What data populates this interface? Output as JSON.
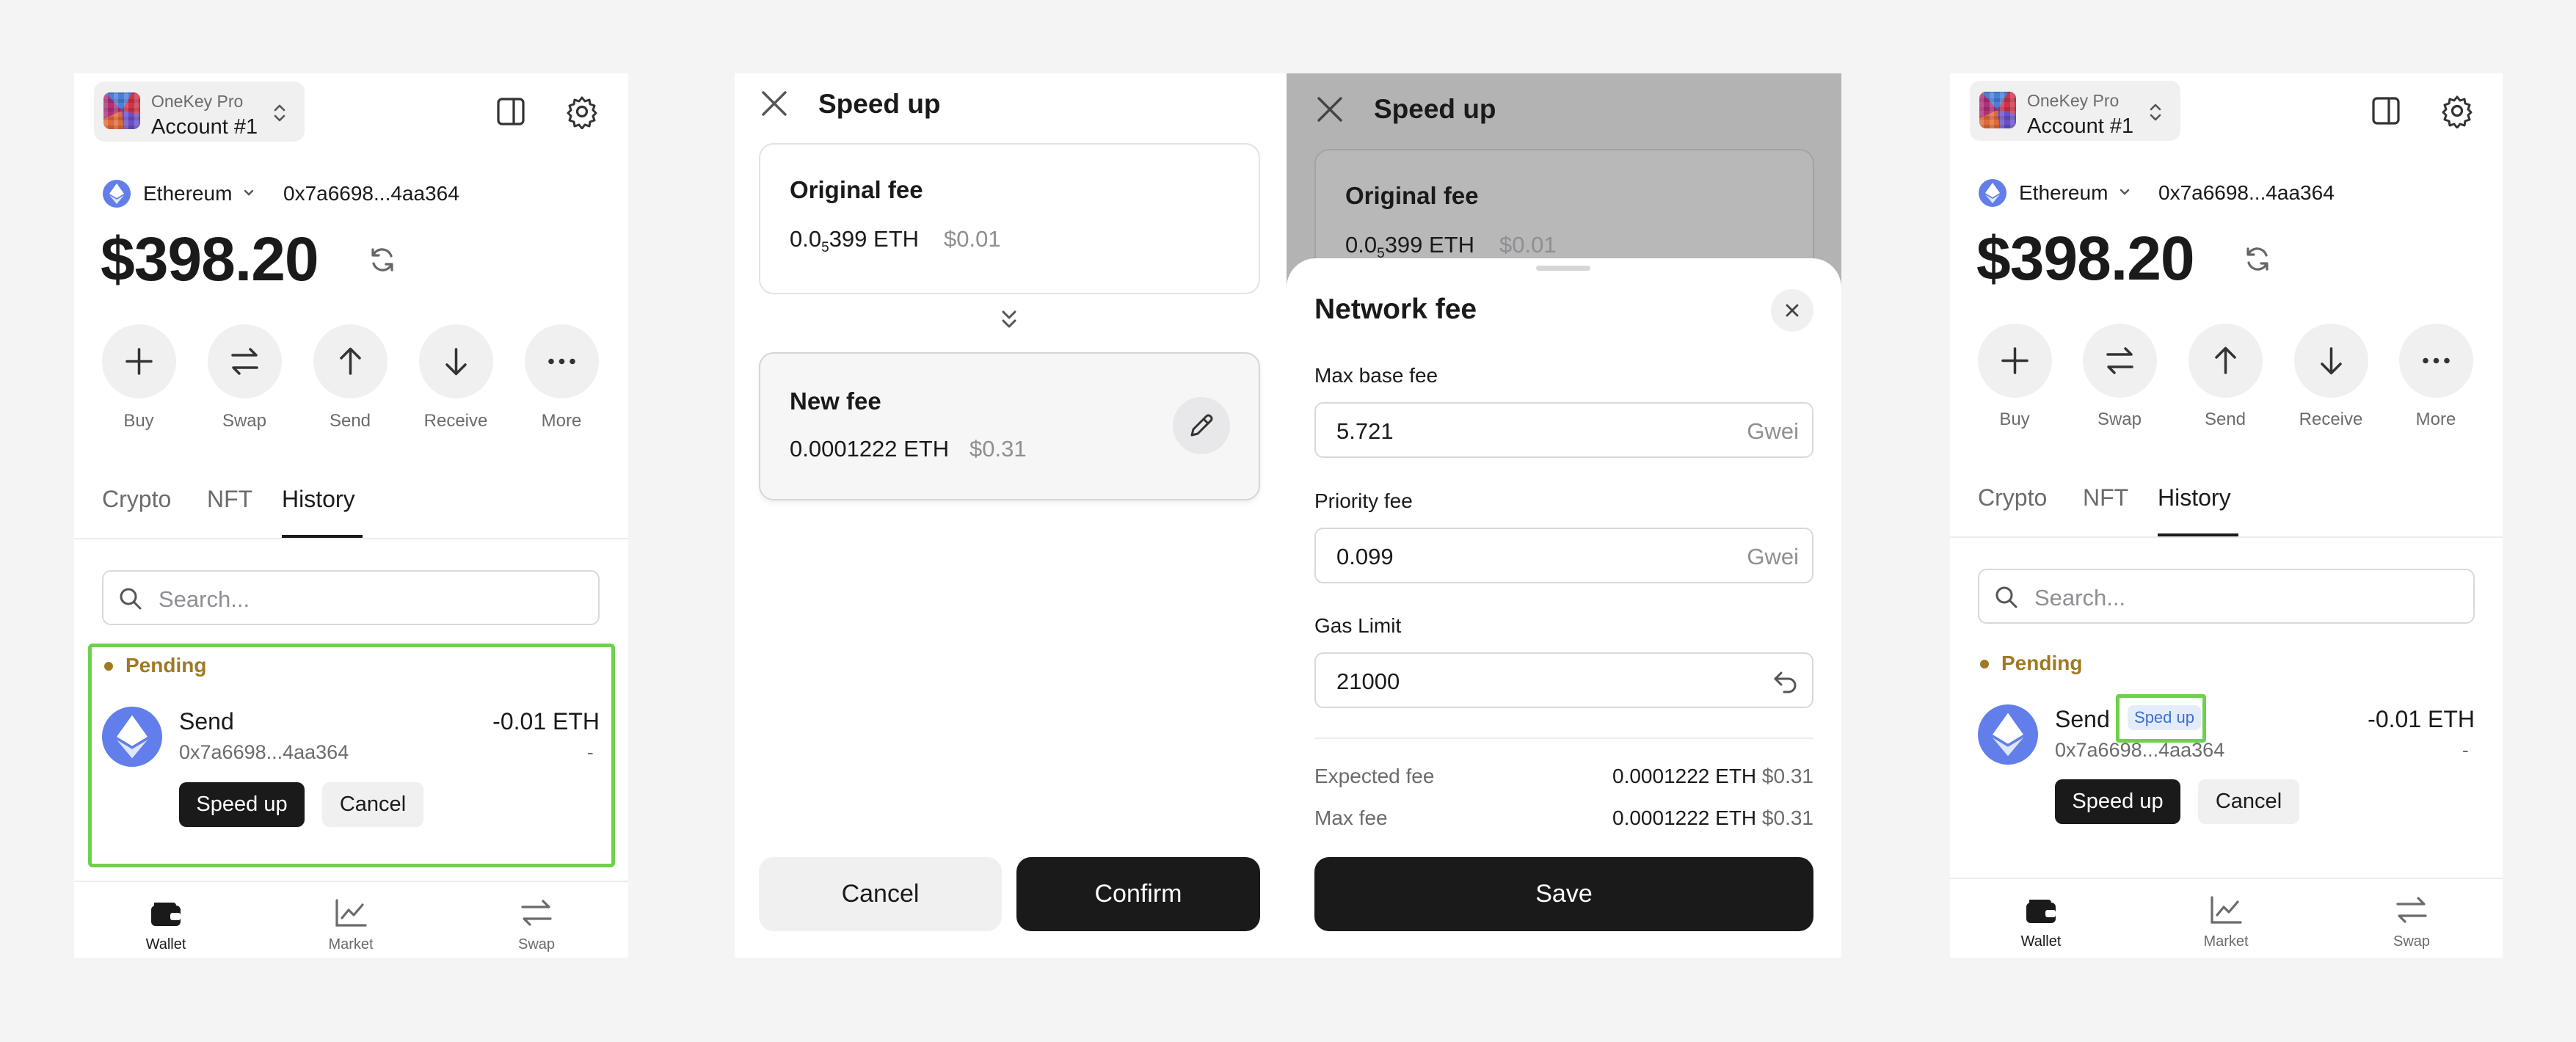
{
  "wallet": {
    "account": {
      "device": "OneKey Pro",
      "name": "Account #1"
    },
    "network": "Ethereum",
    "address": "0x7a6698...4aa364",
    "balance": "$398.20",
    "actions": [
      {
        "label": "Buy",
        "icon": "plus-icon"
      },
      {
        "label": "Swap",
        "icon": "swap-icon"
      },
      {
        "label": "Send",
        "icon": "arrow-up-icon"
      },
      {
        "label": "Receive",
        "icon": "arrow-down-icon"
      },
      {
        "label": "More",
        "icon": "more-icon"
      }
    ],
    "tabs": [
      "Crypto",
      "NFT",
      "History"
    ],
    "active_tab": "History",
    "search_placeholder": "Search...",
    "pending_label": "Pending",
    "tx": {
      "title": "Send",
      "address": "0x7a6698...4aa364",
      "amount": "-0.01 ETH",
      "fiat": "-",
      "speed_up": "Speed up",
      "cancel": "Cancel",
      "sped_badge": "Sped up"
    },
    "nav": [
      {
        "label": "Wallet",
        "icon": "wallet-icon"
      },
      {
        "label": "Market",
        "icon": "chart-icon"
      },
      {
        "label": "Swap",
        "icon": "swap-icon"
      }
    ]
  },
  "speedup": {
    "title": "Speed up",
    "original": {
      "label": "Original fee",
      "prefix": "0.0",
      "sub": "5",
      "rest": "399 ETH",
      "fiat": "$0.01"
    },
    "new": {
      "label": "New fee",
      "value": "0.0001222 ETH",
      "fiat": "$0.31"
    },
    "cancel": "Cancel",
    "confirm": "Confirm"
  },
  "network_fee": {
    "title": "Network fee",
    "max_base_fee": {
      "label": "Max base fee",
      "value": "5.721",
      "unit": "Gwei"
    },
    "priority_fee": {
      "label": "Priority fee",
      "value": "0.099",
      "unit": "Gwei"
    },
    "gas_limit": {
      "label": "Gas Limit",
      "value": "21000"
    },
    "expected_fee": {
      "label": "Expected fee",
      "value": "0.0001222 ETH",
      "fiat": "$0.31"
    },
    "max_fee": {
      "label": "Max fee",
      "value": "0.0001222 ETH",
      "fiat": "$0.31"
    },
    "save": "Save"
  },
  "colors": {
    "accent_green": "#6dd14b",
    "pending": "#a07a23",
    "eth": "#627eea",
    "badge_text": "#3b6fd4"
  }
}
